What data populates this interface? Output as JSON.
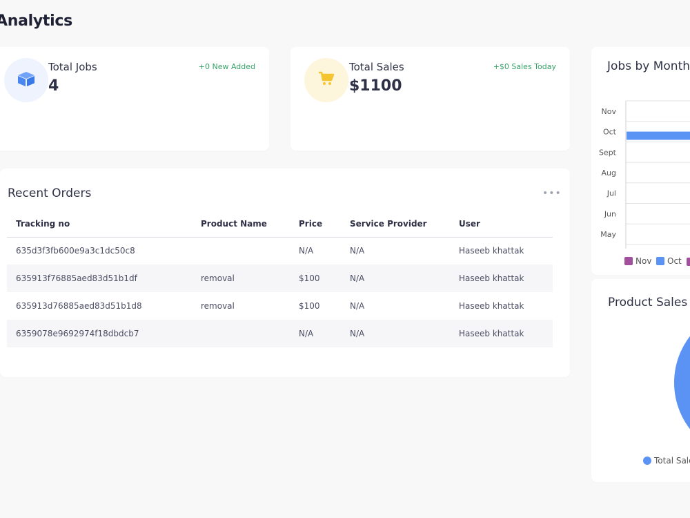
{
  "page": {
    "title": "Analytics"
  },
  "stats": {
    "jobs": {
      "title": "Total Jobs",
      "value": "4",
      "badge": "+0 New Added",
      "icon": "box-icon",
      "accent": "#4a8cf7",
      "bg": "#eef3fd"
    },
    "sales": {
      "title": "Total Sales",
      "value": "$1100",
      "badge": "+$0 Sales Today",
      "icon": "cart-icon",
      "accent": "#f5c431",
      "bg": "#fdf6dd"
    }
  },
  "orders": {
    "title": "Recent Orders",
    "menu_icon": "more-horizontal-icon",
    "columns": [
      "Tracking no",
      "Product Name",
      "Price",
      "Service Provider",
      "User"
    ],
    "rows": [
      [
        "635d3f3fb600e9a3c1dc50c8",
        "",
        "N/A",
        "N/A",
        "Haseeb khattak"
      ],
      [
        "635913f76885aed83d51b1df",
        "removal",
        "$100",
        "N/A",
        "Haseeb khattak"
      ],
      [
        "635913d76885aed83d51b1d8",
        "removal",
        "$100",
        "N/A",
        "Haseeb khattak"
      ],
      [
        "6359078e9692974f18dbdcb7",
        "",
        "N/A",
        "N/A",
        "Haseeb khattak"
      ]
    ]
  },
  "jobs_chart": {
    "title": "Jobs by Month",
    "legend": [
      {
        "label": "Nov",
        "color": "#a0509c"
      },
      {
        "label": "Oct",
        "color": "#5b93f5"
      }
    ]
  },
  "product_sales": {
    "title": "Product Sales",
    "legend": [
      {
        "label": "Total Sale",
        "color": "#5b93f5"
      }
    ]
  },
  "chart_data": {
    "type": "bar",
    "orientation": "horizontal",
    "categories": [
      "Nov",
      "Oct",
      "Sept",
      "Aug",
      "Jul",
      "Jun",
      "May"
    ],
    "series": [
      {
        "name": "Nov",
        "color": "#a0509c",
        "values": [
          0,
          0,
          0,
          0,
          0,
          0,
          0
        ]
      },
      {
        "name": "Oct",
        "color": "#5b93f5",
        "values": [
          0,
          4,
          0,
          0,
          0,
          0,
          0
        ]
      }
    ],
    "grid": true,
    "legend": "bottom"
  }
}
